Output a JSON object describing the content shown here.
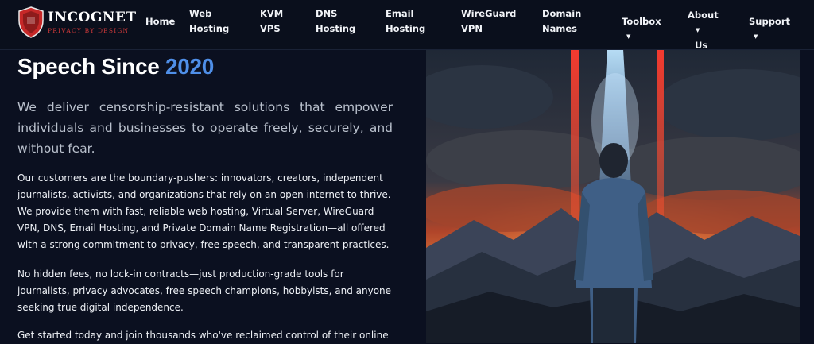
{
  "brand": {
    "name": "INCOGNET",
    "tagline": "PRIVACY BY DESIGN",
    "accent": "#d23a3a"
  },
  "nav": {
    "home": [
      "Home"
    ],
    "web_hosting": [
      "Web",
      "Hosting"
    ],
    "kvm_vps": [
      "KVM",
      "VPS"
    ],
    "dns_hosting": [
      "DNS",
      "Hosting"
    ],
    "email_hosting": [
      "Email",
      "Hosting"
    ],
    "wireguard_vpn": [
      "WireGuard",
      "VPN"
    ],
    "domain_names": [
      "Domain",
      "Names"
    ],
    "toolbox": [
      "Toolbox"
    ],
    "about_us": [
      "About",
      "Us"
    ],
    "support": [
      "Support"
    ]
  },
  "hero": {
    "heading": "Speech Since ",
    "heading_year": "2020",
    "lead": "We deliver censorship-resistant solutions that empower individuals and businesses to operate freely, securely, and without fear.",
    "paragraph1": "Our customers are the boundary-pushers: innovators, creators, independent journalists, activists, and organizations that rely on an open internet to thrive. We provide them with fast, reliable web hosting, Virtual Server, WireGuard VPN, DNS, Email Hosting, and Private Domain Name Registration—all offered with a strong commitment to privacy, free speech, and transparent practices.",
    "paragraph2": "No hidden fees, no lock-in contracts—just production-grade tools for journalists, privacy advocates, free speech champions, hobbyists, and anyone seeking true digital independence.",
    "paragraph3": "Get started today and join thousands who've reclaimed control of their online",
    "year_color": "#4f8fe8"
  },
  "icons": {
    "logo": "shield-icon",
    "dropdown": "caret-down-icon"
  }
}
